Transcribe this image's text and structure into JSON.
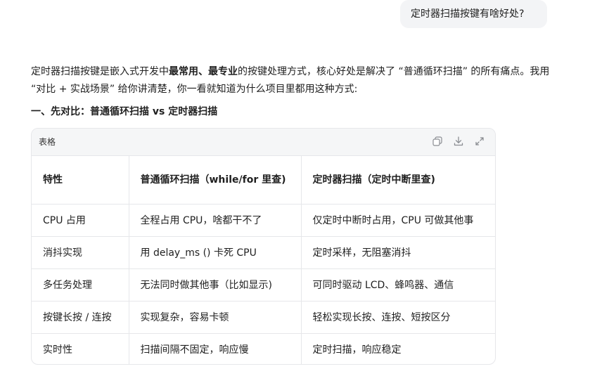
{
  "user_message": "定时器扫描按键有啥好处?",
  "answer": {
    "intro_part1": "定时器扫描按键是嵌入式开发中",
    "intro_bold": "最常用、最专业",
    "intro_part2": "的按键处理方式，核心好处是解决了 “普通循环扫描” 的所有痛点。我用 “对比 + 实战场景” 给你讲清楚，你一看就知道为什么项目里都用这种方式:",
    "section_heading": "一、先对比：普通循环扫描 vs 定时器扫描"
  },
  "table": {
    "label": "表格",
    "toolbar_icons": [
      "copy-icon",
      "download-icon",
      "expand-icon"
    ],
    "headers": [
      "特性",
      "普通循环扫描（while/for 里查)",
      "定时器扫描（定时中断里查)"
    ],
    "rows": [
      [
        "CPU 占用",
        "全程占用 CPU，啥都干不了",
        "仅定时中断时占用，CPU 可做其他事"
      ],
      [
        "消抖实现",
        "用 delay_ms () 卡死 CPU",
        "定时采样，无阻塞消抖"
      ],
      [
        "多任务处理",
        "无法同时做其他事（比如显示)",
        "可同时驱动 LCD、蜂鸣器、通信"
      ],
      [
        "按键长按 / 连按",
        "实现复杂，容易卡顿",
        "轻松实现长按、连按、短按区分"
      ],
      [
        "实时性",
        "扫描间隔不固定，响应慢",
        "定时扫描，响应稳定"
      ]
    ]
  }
}
